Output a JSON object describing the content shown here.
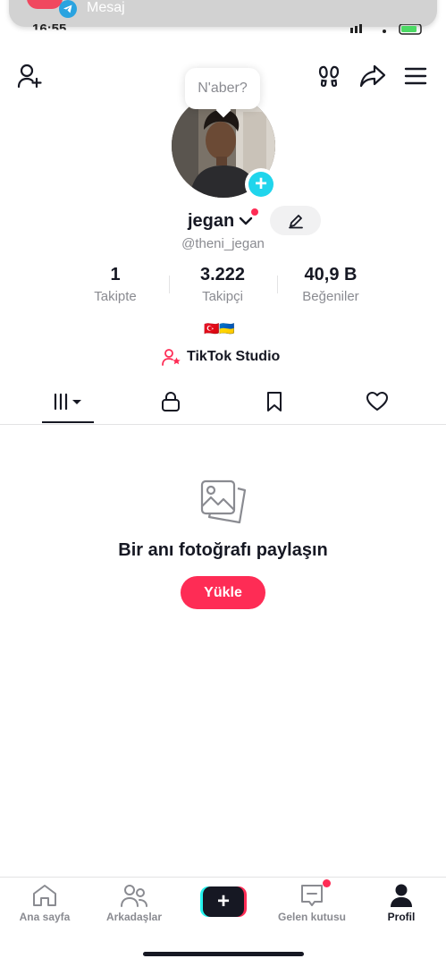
{
  "notification": {
    "title": "Mesaj"
  },
  "status_bar": {
    "time": "16:55"
  },
  "profile": {
    "bubble_text": "N'aber?",
    "display_name": "jegan",
    "handle": "@theni_jegan",
    "flags": "🇹🇷🇺🇦",
    "studio_label": "TikTok Studio"
  },
  "stats": [
    {
      "value": "1",
      "label": "Takipte"
    },
    {
      "value": "3.222",
      "label": "Takipçi"
    },
    {
      "value": "40,9 B",
      "label": "Beğeniler"
    }
  ],
  "empty_state": {
    "title": "Bir anı fotoğrafı paylaşın",
    "button": "Yükle"
  },
  "bottom_nav": [
    {
      "label": "Ana sayfa",
      "icon": "home-icon"
    },
    {
      "label": "Arkadaşlar",
      "icon": "friends-icon"
    },
    {
      "label": "",
      "icon": "create-icon"
    },
    {
      "label": "Gelen kutusu",
      "icon": "inbox-icon"
    },
    {
      "label": "Profil",
      "icon": "profile-icon"
    }
  ],
  "colors": {
    "accent": "#fe2c55",
    "cyan": "#20d5ec",
    "text": "#161823",
    "muted": "#8a8b91"
  }
}
